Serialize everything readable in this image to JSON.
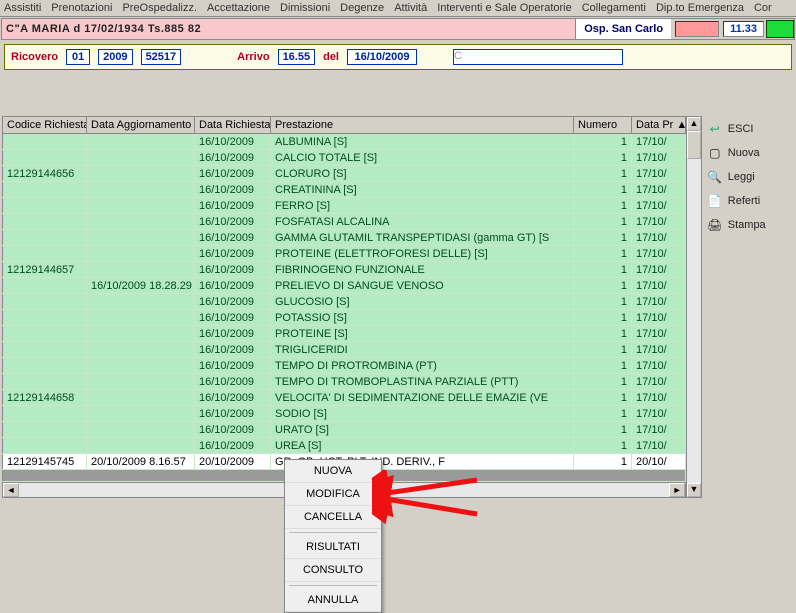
{
  "menu": [
    "Assistiti",
    "Prenotazioni",
    "PreOspedalizz.",
    "Accettazione",
    "Dimissioni",
    "Degenze",
    "Attività",
    "Interventi e Sale Operatorie",
    "Collegamenti",
    "Dip.to Emergenza",
    "Cor"
  ],
  "patient_header": "C\"A     MARIA               d  17/02/1934    Ts.885 82",
  "osp": "Osp. San Carlo",
  "clock": "11.33",
  "ricovero": {
    "label": "Ricovero",
    "num1": "01",
    "num2": "2009",
    "num3": "52517",
    "arrivo_label": "Arrivo",
    "arrivo": "16.55",
    "del_label": "del",
    "del": "16/10/2009",
    "patient": "C                       "
  },
  "columns": [
    "Codice Richiesta",
    "Data Aggiornamento",
    "Data  Richiesta",
    "Prestazione",
    "Numero",
    "Data Pr"
  ],
  "rows": [
    {
      "g": 1,
      "cod": "",
      "agg": "",
      "data": "16/10/2009",
      "prest": "ALBUMINA [S]",
      "num": "1",
      "dp": "17/10/"
    },
    {
      "g": 1,
      "cod": "",
      "agg": "",
      "data": "16/10/2009",
      "prest": "CALCIO TOTALE [S]",
      "num": "1",
      "dp": "17/10/"
    },
    {
      "g": 1,
      "cod": "12129144656",
      "agg": "",
      "data": "16/10/2009",
      "prest": "CLORURO [S]",
      "num": "1",
      "dp": "17/10/"
    },
    {
      "g": 1,
      "cod": "",
      "agg": "",
      "data": "16/10/2009",
      "prest": "CREATININA [S]",
      "num": "1",
      "dp": "17/10/"
    },
    {
      "g": 1,
      "cod": "",
      "agg": "",
      "data": "16/10/2009",
      "prest": "FERRO [S]",
      "num": "1",
      "dp": "17/10/"
    },
    {
      "g": 1,
      "cod": "",
      "agg": "",
      "data": "16/10/2009",
      "prest": "FOSFATASI ALCALINA",
      "num": "1",
      "dp": "17/10/"
    },
    {
      "g": 1,
      "cod": "",
      "agg": "",
      "data": "16/10/2009",
      "prest": "GAMMA GLUTAMIL TRANSPEPTIDASI (gamma GT) [S",
      "num": "1",
      "dp": "17/10/"
    },
    {
      "g": 1,
      "cod": "",
      "agg": "",
      "data": "16/10/2009",
      "prest": "PROTEINE (ELETTROFORESI DELLE) [S]",
      "num": "1",
      "dp": "17/10/"
    },
    {
      "g": 1,
      "cod": "12129144657",
      "agg": "",
      "data": "16/10/2009",
      "prest": "FIBRINOGENO FUNZIONALE",
      "num": "1",
      "dp": "17/10/"
    },
    {
      "g": 1,
      "cod": "",
      "agg": "16/10/2009 18.28.29",
      "data": "16/10/2009",
      "prest": "PRELIEVO DI SANGUE VENOSO",
      "num": "1",
      "dp": "17/10/"
    },
    {
      "g": 1,
      "cod": "",
      "agg": "",
      "data": "16/10/2009",
      "prest": "GLUCOSIO [S]",
      "num": "1",
      "dp": "17/10/"
    },
    {
      "g": 1,
      "cod": "",
      "agg": "",
      "data": "16/10/2009",
      "prest": "POTASSIO [S]",
      "num": "1",
      "dp": "17/10/"
    },
    {
      "g": 1,
      "cod": "",
      "agg": "",
      "data": "16/10/2009",
      "prest": "PROTEINE [S]",
      "num": "1",
      "dp": "17/10/"
    },
    {
      "g": 1,
      "cod": "",
      "agg": "",
      "data": "16/10/2009",
      "prest": "TRIGLICERIDI",
      "num": "1",
      "dp": "17/10/"
    },
    {
      "g": 1,
      "cod": "",
      "agg": "",
      "data": "16/10/2009",
      "prest": "TEMPO DI PROTROMBINA (PT)",
      "num": "1",
      "dp": "17/10/"
    },
    {
      "g": 1,
      "cod": "",
      "agg": "",
      "data": "16/10/2009",
      "prest": "TEMPO DI TROMBOPLASTINA PARZIALE (PTT)",
      "num": "1",
      "dp": "17/10/"
    },
    {
      "g": 1,
      "cod": "12129144658",
      "agg": "",
      "data": "16/10/2009",
      "prest": "VELOCITA' DI SEDIMENTAZIONE DELLE EMAZIE (VE",
      "num": "1",
      "dp": "17/10/"
    },
    {
      "g": 1,
      "cod": "",
      "agg": "",
      "data": "16/10/2009",
      "prest": "SODIO [S]",
      "num": "1",
      "dp": "17/10/"
    },
    {
      "g": 1,
      "cod": "",
      "agg": "",
      "data": "16/10/2009",
      "prest": "URATO [S]",
      "num": "1",
      "dp": "17/10/"
    },
    {
      "g": 1,
      "cod": "",
      "agg": "",
      "data": "16/10/2009",
      "prest": "UREA [S]",
      "num": "1",
      "dp": "17/10/"
    },
    {
      "g": 0,
      "cod": "12129145745",
      "agg": "20/10/2009 8.16.57",
      "data": "20/10/2009",
      "prest": "             GR, GB, HCT, PLT, IND. DERIV., F",
      "num": "1",
      "dp": "20/10/"
    }
  ],
  "sidebar": [
    {
      "icon": "↩",
      "label": "ESCI",
      "name": "esci"
    },
    {
      "icon": "▢",
      "label": "Nuova",
      "name": "nuova"
    },
    {
      "icon": "🔍",
      "label": "Leggi",
      "name": "leggi"
    },
    {
      "icon": "📄",
      "label": "Referti",
      "name": "referti"
    },
    {
      "icon": "🖨",
      "label": "Stampa",
      "name": "stampa"
    }
  ],
  "context_menu": [
    "NUOVA",
    "MODIFICA",
    "CANCELLA",
    "",
    "RISULTATI",
    "CONSULTO",
    "",
    "ANNULLA"
  ]
}
